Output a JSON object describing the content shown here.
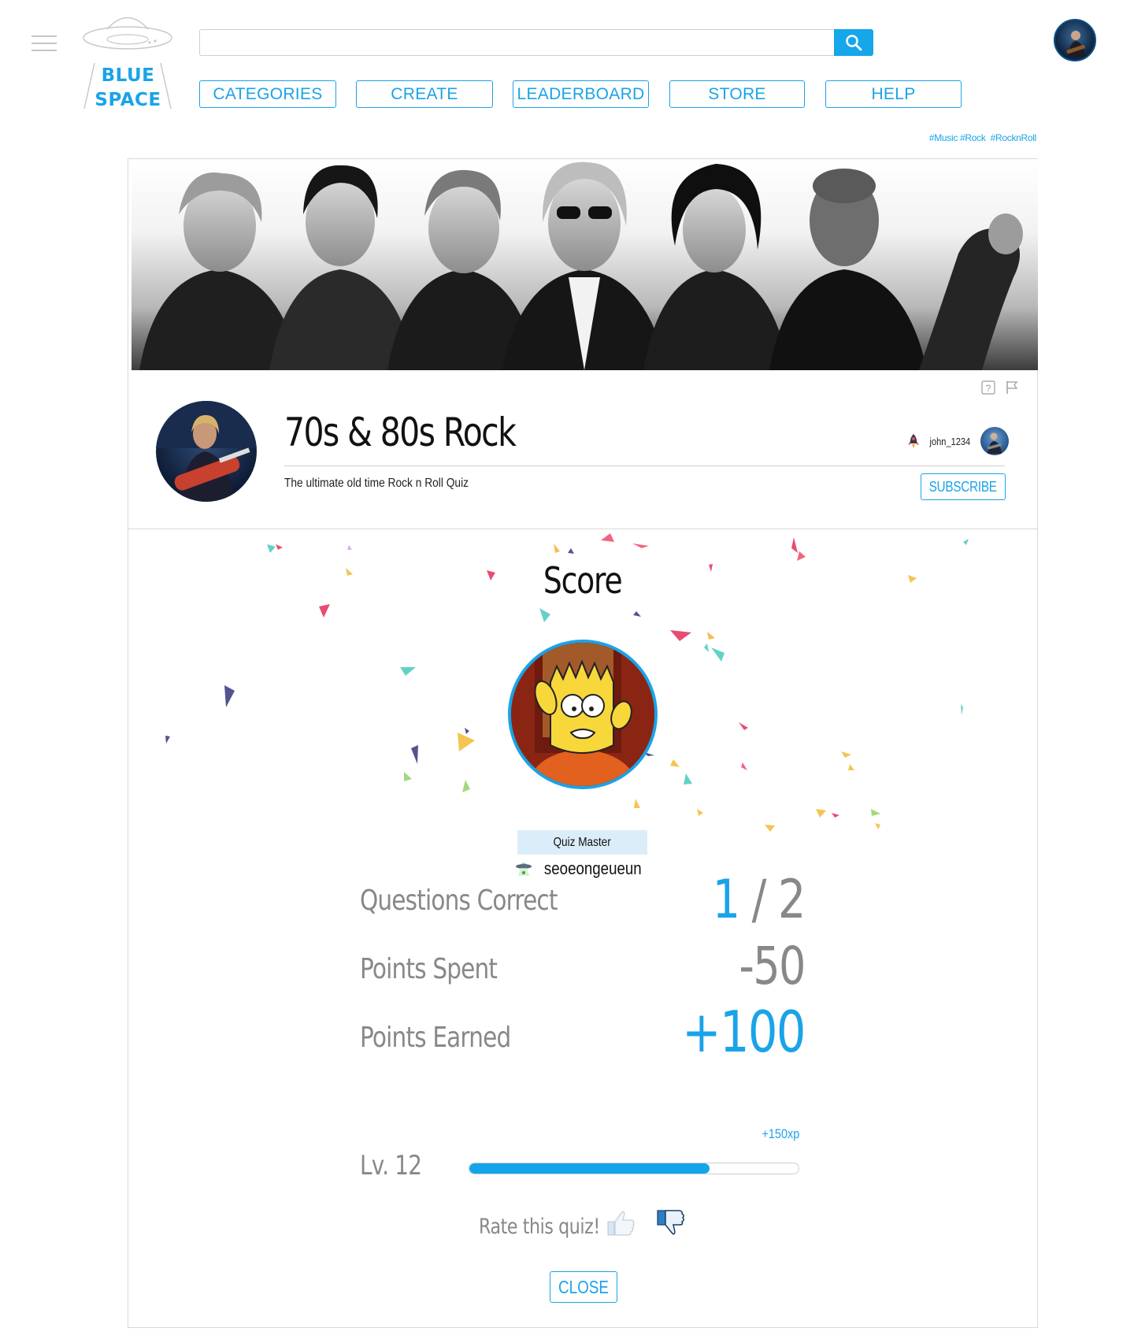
{
  "header": {
    "logo": {
      "line1": "BLUE",
      "line2": "SPACE"
    },
    "search": {
      "value": "",
      "placeholder": ""
    },
    "nav": [
      {
        "label": "CATEGORIES"
      },
      {
        "label": "CREATE"
      },
      {
        "label": "LEADERBOARD"
      },
      {
        "label": "STORE"
      },
      {
        "label": "HELP"
      }
    ]
  },
  "hashtags": [
    "#Music",
    "#Rock",
    "#RocknRoll"
  ],
  "quiz": {
    "title": "70s & 80s Rock",
    "subtitle": "The ultimate old time Rock n Roll Quiz",
    "author": "john_1234",
    "subscribe_label": "SUBSCRIBE"
  },
  "score": {
    "title": "Score",
    "badge": "Quiz Master",
    "player_name": "seoeongeueun",
    "stats": [
      {
        "label": "Questions Correct",
        "correct": "1",
        "separator": " / ",
        "total": "2"
      },
      {
        "label": "Points Spent",
        "value": "-50"
      },
      {
        "label": "Points Earned",
        "value": "+100"
      }
    ],
    "xp_gain": "+150xp",
    "level_label": "Lv. 12",
    "level_progress": 0.73,
    "rate_label": "Rate this quiz!",
    "close_label": "CLOSE"
  },
  "icons": {
    "menu": "hamburger-icon",
    "search": "search-icon",
    "help": "question-icon",
    "report": "flag-icon",
    "author_badge": "rocket-icon",
    "player_badge": "ufo-icon",
    "like": "thumbs-up-icon",
    "dislike": "thumbs-down-icon"
  },
  "colors": {
    "accent": "#1aa3e8",
    "muted_text": "#888888",
    "badge_bg": "#dcedfa"
  }
}
